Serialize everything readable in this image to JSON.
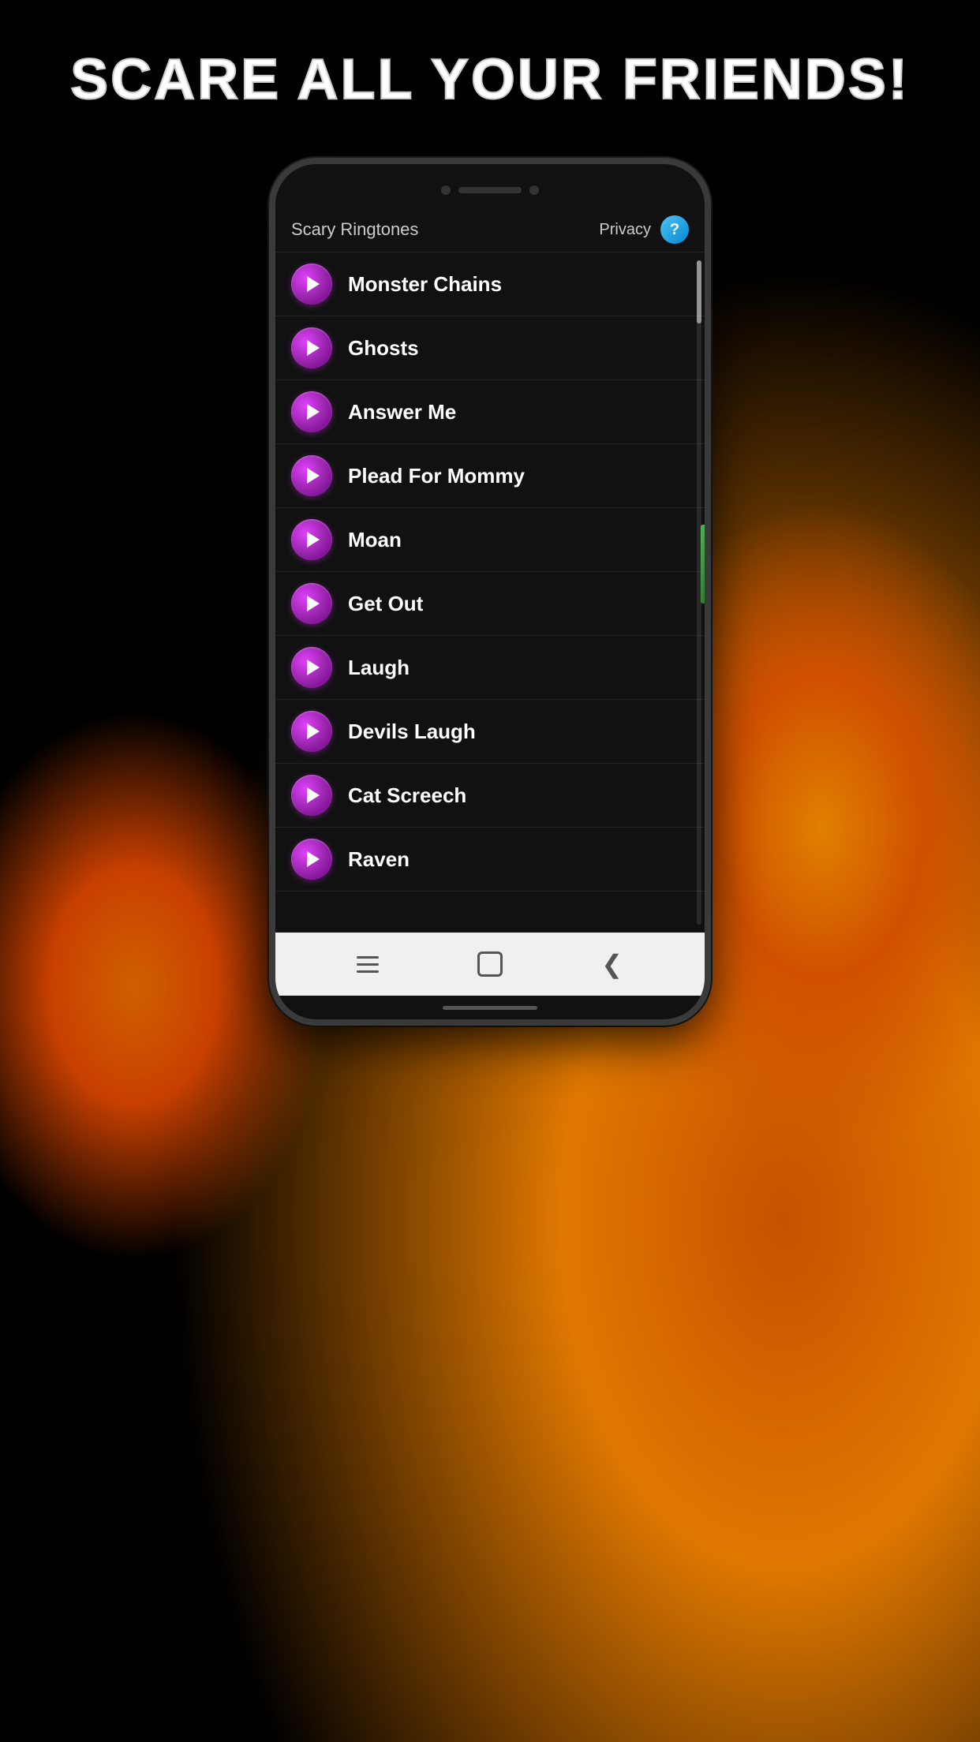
{
  "page": {
    "title": "SCARE ALL YOUR FRIENDS!"
  },
  "header": {
    "app_name": "Scary Ringtones",
    "privacy_label": "Privacy",
    "help_label": "?"
  },
  "nav": {
    "menu_label": "Menu",
    "home_label": "Home",
    "back_label": "Back"
  },
  "ringtones": [
    {
      "id": 1,
      "name": "Monster Chains"
    },
    {
      "id": 2,
      "name": "Ghosts"
    },
    {
      "id": 3,
      "name": "Answer Me"
    },
    {
      "id": 4,
      "name": "Plead For Mommy"
    },
    {
      "id": 5,
      "name": "Moan"
    },
    {
      "id": 6,
      "name": "Get Out"
    },
    {
      "id": 7,
      "name": "Laugh"
    },
    {
      "id": 8,
      "name": "Devils Laugh"
    },
    {
      "id": 9,
      "name": "Cat Screech"
    },
    {
      "id": 10,
      "name": "Raven"
    }
  ]
}
